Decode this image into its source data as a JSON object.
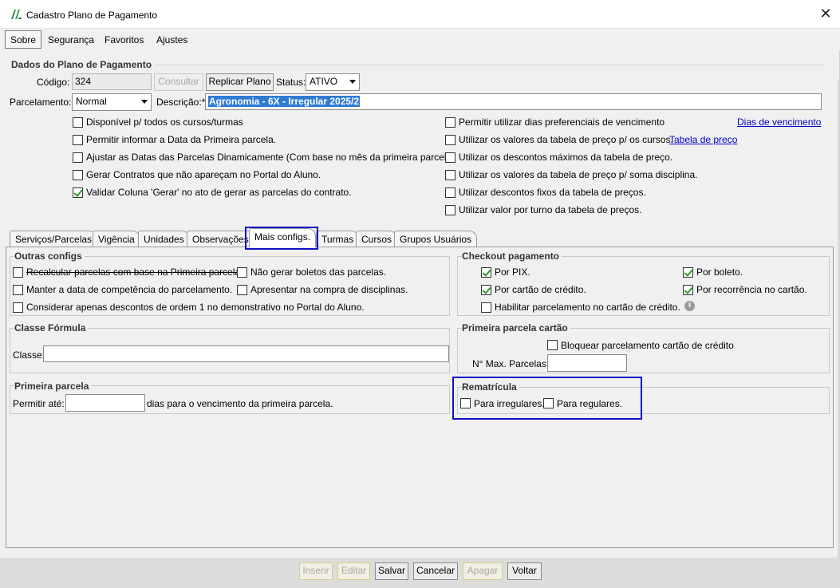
{
  "window": {
    "title": "Cadastro Plano de Pagamento",
    "close": "✕"
  },
  "menu": [
    "Sobre",
    "Segurança",
    "Favoritos",
    "Ajustes"
  ],
  "dados": {
    "section_title": "Dados do Plano de Pagamento",
    "codigo_label": "Código:",
    "codigo_value": "324",
    "consultar": "Consultar",
    "replicar": "Replicar Plano",
    "status_label": "Status:",
    "status_value": "ATIVO",
    "parcelamento_label": "Parcelamento:",
    "parcelamento_value": "Normal",
    "descricao_label": "Descrição:*",
    "descricao_value": "Agronomia - 6X - Irregular 2025/2"
  },
  "left_checks": [
    {
      "label": "Disponível p/ todos os cursos/turmas",
      "checked": false
    },
    {
      "label": "Permitir informar a Data da Primeira parcela.",
      "checked": false
    },
    {
      "label": "Ajustar as Datas das Parcelas Dinamicamente (Com base no mês da primeira parcela)",
      "checked": false
    },
    {
      "label": "Gerar Contratos que não apareçam no Portal do Aluno.",
      "checked": false
    },
    {
      "label": "Validar Coluna 'Gerar' no ato de gerar as parcelas do contrato.",
      "checked": true
    }
  ],
  "right_checks": [
    {
      "label": "Permitir utilizar dias preferenciais de vencimento",
      "checked": false
    },
    {
      "label": "Utilizar os valores da tabela de preço p/ os cursos.",
      "checked": false
    },
    {
      "label": "Utilizar os descontos máximos da tabela de preço.",
      "checked": false
    },
    {
      "label": "Utilizar os valores da tabela de preço p/ soma disciplina.",
      "checked": false
    },
    {
      "label": "Utilizar descontos fixos da tabela de preços.",
      "checked": false
    },
    {
      "label": "Utilizar valor por turno da tabela de preços.",
      "checked": false
    }
  ],
  "links": {
    "dias": "Dias de vencimento",
    "tabela": "Tabela de preço"
  },
  "tabs": [
    "Serviços/Parcelas",
    "Vigência",
    "Unidades",
    "Observações",
    "Mais configs.",
    "Turmas",
    "Cursos",
    "Grupos Usuários"
  ],
  "outras": {
    "title": "Outras configs",
    "items": [
      {
        "label": "Recalcular parcelas com base na Primeira parcela.",
        "checked": false
      },
      {
        "label": "Não gerar boletos das parcelas.",
        "checked": false
      },
      {
        "label": "Manter a data de competência do parcelamento.",
        "checked": false
      },
      {
        "label": "Apresentar na compra de disciplinas.",
        "checked": false
      },
      {
        "label": "Considerar apenas descontos de ordem 1 no demonstrativo no Portal do Aluno.",
        "checked": false
      }
    ]
  },
  "checkout": {
    "title": "Checkout pagamento",
    "items": [
      {
        "label": "Por PIX.",
        "checked": true
      },
      {
        "label": "Por boleto.",
        "checked": true
      },
      {
        "label": "Por cartão de crédito.",
        "checked": true
      },
      {
        "label": "Por recorrência no cartão.",
        "checked": true
      },
      {
        "label": "Habilitar parcelamento no cartão de crédito.",
        "checked": false
      }
    ],
    "info_icon": "i"
  },
  "classe": {
    "title": "Classe Fórmula",
    "label": "Classe:",
    "value": ""
  },
  "primeira_cartao": {
    "title": "Primeira parcela cartão",
    "bloquear": "Bloquear parcelamento cartão de crédito",
    "max_label": "N° Max. Parcelas:",
    "max_value": ""
  },
  "primeira": {
    "title": "Primeira parcela",
    "label": "Permitir até:",
    "value": "",
    "suffix": "dias para o vencimento da primeira parcela."
  },
  "rematricula": {
    "title": "Rematrícula",
    "irregulares": "Para irregulares.",
    "regulares": "Para regulares."
  },
  "bottom": {
    "inserir": "Inserir",
    "editar": "Editar",
    "salvar": "Salvar",
    "cancelar": "Cancelar",
    "apagar": "Apagar",
    "voltar": "Voltar"
  }
}
